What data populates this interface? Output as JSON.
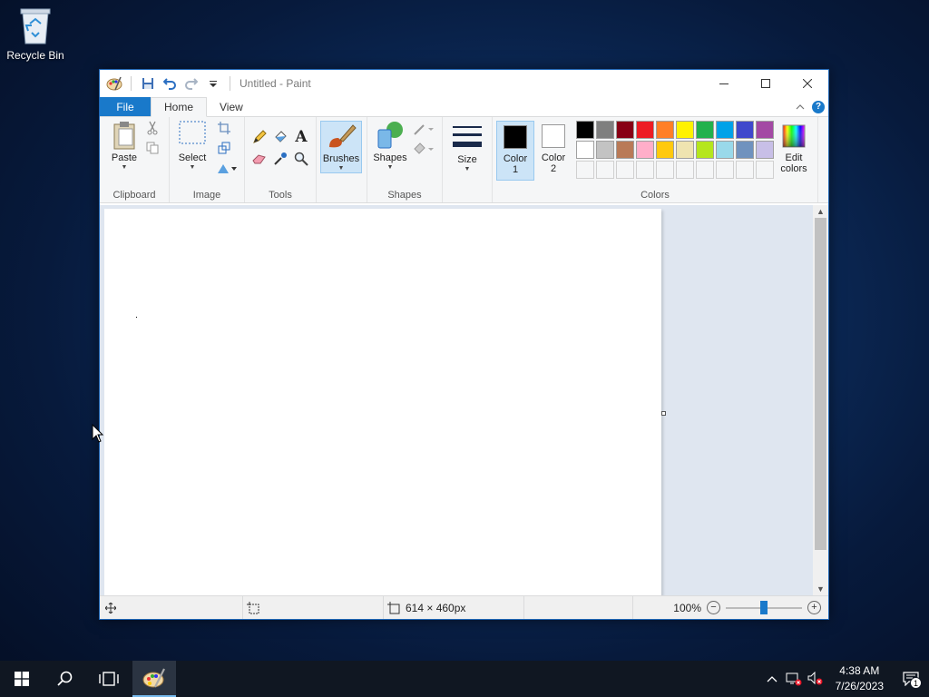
{
  "desktop": {
    "recycle_bin_label": "Recycle Bin"
  },
  "window": {
    "title": "Untitled - Paint",
    "tabs": {
      "file": "File",
      "home": "Home",
      "view": "View"
    }
  },
  "ribbon": {
    "clipboard": {
      "label": "Clipboard",
      "paste": "Paste"
    },
    "image": {
      "label": "Image",
      "select": "Select"
    },
    "tools": {
      "label": "Tools"
    },
    "brushes": {
      "label": "Brushes"
    },
    "shapes": {
      "label": "Shapes",
      "button": "Shapes"
    },
    "size": {
      "label": "Size"
    },
    "colors": {
      "label": "Colors",
      "color1_line1": "Color",
      "color1_line2": "1",
      "color2_line1": "Color",
      "color2_line2": "2",
      "edit_line1": "Edit",
      "edit_line2": "colors",
      "color1_value": "#000000",
      "color2_value": "#ffffff",
      "palette_row1": [
        "#000000",
        "#7f7f7f",
        "#880015",
        "#ed1c24",
        "#ff7f27",
        "#fff200",
        "#22b14c",
        "#00a2e8",
        "#3f48cc",
        "#a349a4"
      ],
      "palette_row2": [
        "#ffffff",
        "#c3c3c3",
        "#b97a57",
        "#ffaec9",
        "#ffc90e",
        "#efe4b0",
        "#b5e61d",
        "#99d9ea",
        "#7092be",
        "#c8bfe7"
      ],
      "palette_row3_empty": 10
    }
  },
  "status": {
    "canvas_size": "614 × 460px",
    "zoom": "100%",
    "zoom_level": 0.5
  },
  "taskbar": {
    "time": "4:38 AM",
    "date": "7/26/2023",
    "notification_count": "1"
  }
}
